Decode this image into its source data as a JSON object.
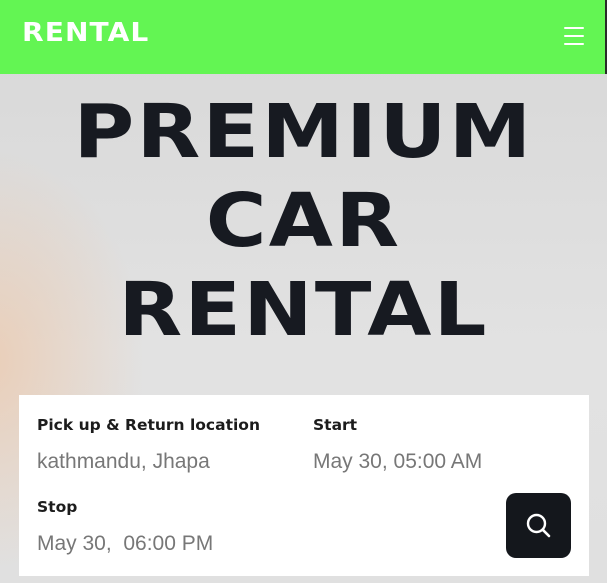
{
  "navbar": {
    "brand": "RENTAL",
    "menu_icon": "hamburger-menu-icon",
    "background_color": "#63f553"
  },
  "hero": {
    "line1": "PREMIUM",
    "line2": "CAR",
    "line3": "RENTAL"
  },
  "search": {
    "location_label": "Pick up & Return location",
    "location_value": "kathmandu, Jhapa",
    "start_label": "Start",
    "start_value": "May 30, 05:00 AM",
    "stop_label": "Stop",
    "stop_value": "May 30,  06:00 PM",
    "search_icon": "search-icon",
    "button_color": "#14171c"
  }
}
